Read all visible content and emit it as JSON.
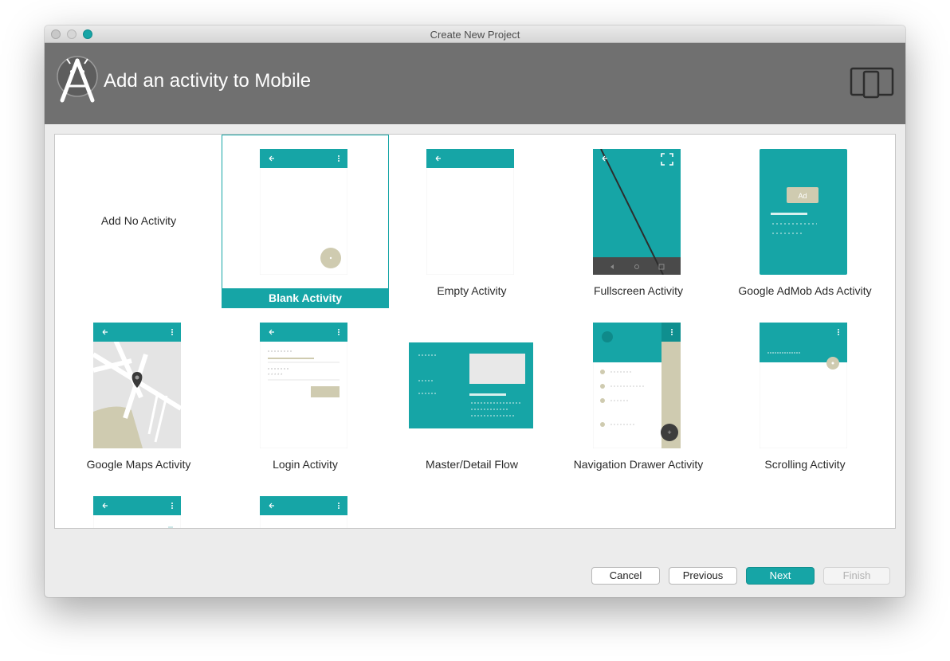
{
  "window": {
    "title": "Create New Project"
  },
  "header": {
    "title": "Add an activity to Mobile",
    "logo_icon": "android-studio-logo-icon",
    "device_icon": "phone-tablet-icon"
  },
  "gallery": {
    "items": [
      {
        "label": "Add No Activity",
        "selected": false
      },
      {
        "label": "Blank Activity",
        "selected": true
      },
      {
        "label": "Empty Activity",
        "selected": false
      },
      {
        "label": "Fullscreen Activity",
        "selected": false
      },
      {
        "label": "Google AdMob Ads Activity",
        "selected": false
      },
      {
        "label": "Google Maps Activity",
        "selected": false
      },
      {
        "label": "Login Activity",
        "selected": false
      },
      {
        "label": "Master/Detail Flow",
        "selected": false
      },
      {
        "label": "Navigation Drawer Activity",
        "selected": false
      },
      {
        "label": "Scrolling Activity",
        "selected": false
      }
    ],
    "ad_thumb_text": "Ad"
  },
  "buttons": {
    "cancel": "Cancel",
    "previous": "Previous",
    "next": "Next",
    "finish": "Finish"
  },
  "colors": {
    "accent": "#16a5a6",
    "header": "#707070",
    "thumb_beige": "#cfcbb0"
  }
}
